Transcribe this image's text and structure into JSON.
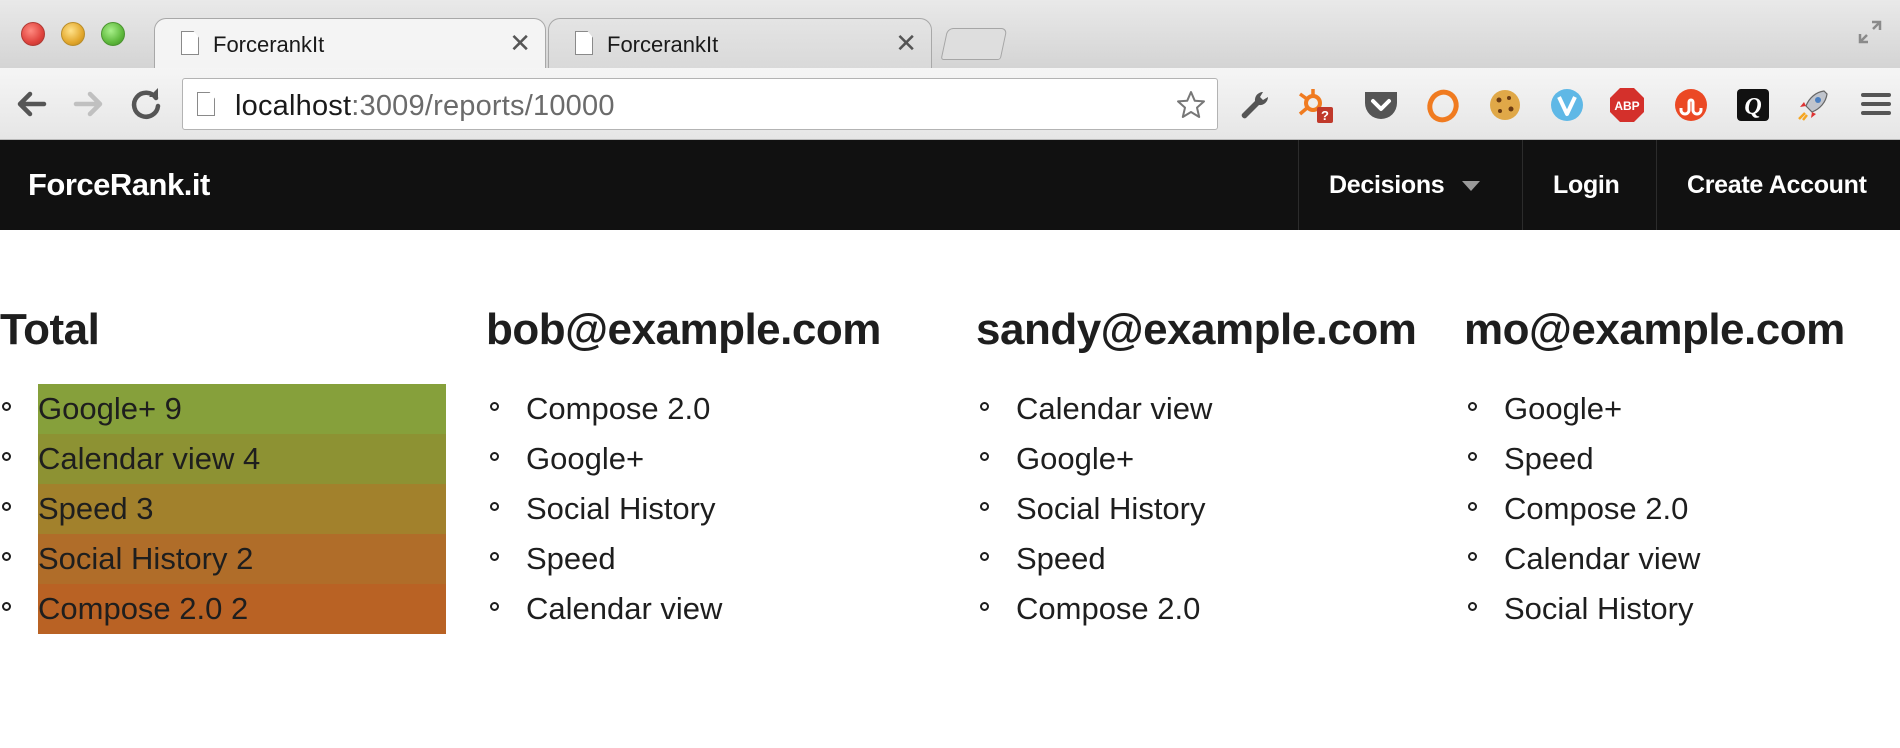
{
  "browser": {
    "tabs": [
      {
        "title": "ForcerankIt",
        "active": true
      },
      {
        "title": "ForcerankIt",
        "active": false
      }
    ],
    "url_host": "localhost",
    "url_rest": ":3009/reports/10000",
    "close_glyph": "✕",
    "extensions": [
      "wrench-icon",
      "hubspot-icon",
      "pocket-icon",
      "ring-icon",
      "cookie-icon",
      "v-icon",
      "adblock-plus-icon",
      "stumbleupon-icon",
      "q-icon",
      "rocket-icon"
    ],
    "extension_labels": {
      "adblock": "ABP",
      "q": "Q"
    }
  },
  "app": {
    "brand": "ForceRank.it",
    "nav": {
      "decisions": "Decisions",
      "login": "Login",
      "create_account": "Create Account"
    }
  },
  "report": {
    "columns": [
      {
        "heading": "Total",
        "items": [
          {
            "label": "Google+ 9",
            "color": "#86a03b"
          },
          {
            "label": "Calendar view 4",
            "color": "#8d9233"
          },
          {
            "label": "Speed 3",
            "color": "#a2812c"
          },
          {
            "label": "Social History 2",
            "color": "#b06d29"
          },
          {
            "label": "Compose 2.0 2",
            "color": "#b96224"
          }
        ]
      },
      {
        "heading": "bob@example.com",
        "items": [
          "Compose 2.0",
          "Google+",
          "Social History",
          "Speed",
          "Calendar view"
        ]
      },
      {
        "heading": "sandy@example.com",
        "items": [
          "Calendar view",
          "Google+",
          "Social History",
          "Speed",
          "Compose 2.0"
        ]
      },
      {
        "heading": "mo@example.com",
        "items": [
          "Google+",
          "Speed",
          "Compose 2.0",
          "Calendar view",
          "Social History"
        ]
      }
    ]
  }
}
